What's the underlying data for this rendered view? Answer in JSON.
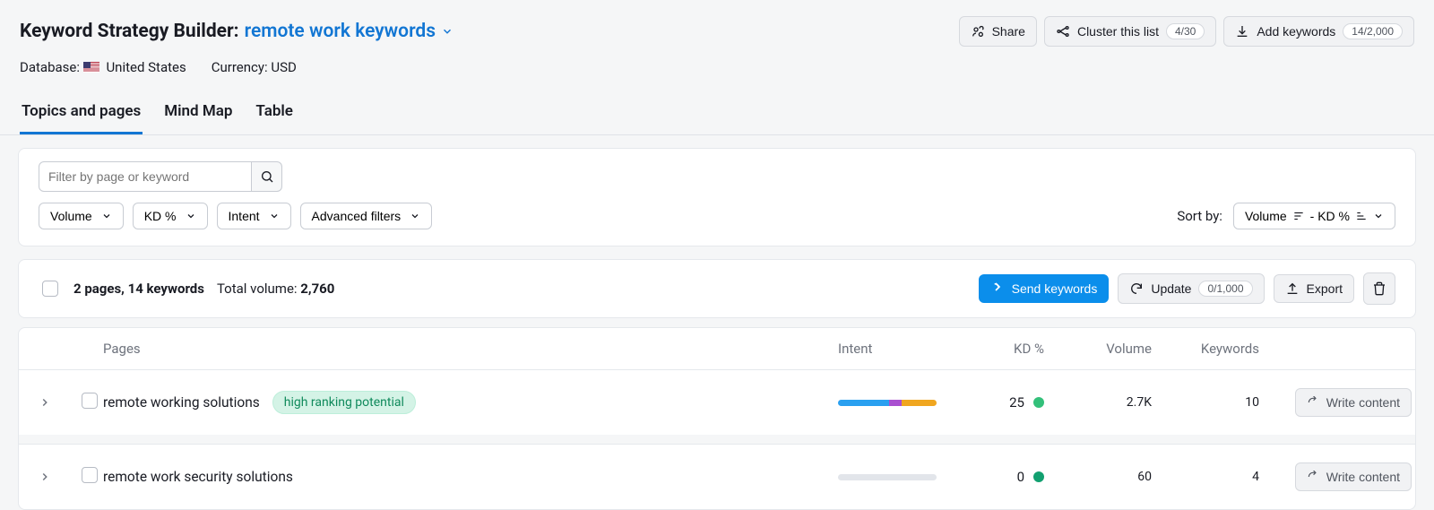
{
  "header": {
    "title_static": "Keyword Strategy Builder:",
    "title_link": "remote work keywords",
    "share_label": "Share",
    "cluster_label": "Cluster this list",
    "cluster_count": "4/30",
    "addkw_label": "Add keywords",
    "addkw_count": "14/2,000",
    "database_label": "Database:",
    "database_value": "United States",
    "currency_label": "Currency:",
    "currency_value": "USD"
  },
  "tabs": {
    "topics": "Topics and pages",
    "mindmap": "Mind Map",
    "table": "Table"
  },
  "filters": {
    "search_placeholder": "Filter by page or keyword",
    "volume": "Volume",
    "kd": "KD %",
    "intent": "Intent",
    "advanced": "Advanced filters",
    "sort_label": "Sort by:",
    "sort_value": "Volume",
    "sort_value2": "- KD %"
  },
  "summary": {
    "pages_keywords": "2 pages, 14 keywords",
    "total_volume_label": "Total volume:",
    "total_volume_value": "2,760",
    "send_label": "Send keywords",
    "update_label": "Update",
    "update_count": "0/1,000",
    "export_label": "Export"
  },
  "columns": {
    "pages": "Pages",
    "intent": "Intent",
    "kd": "KD %",
    "volume": "Volume",
    "keywords": "Keywords"
  },
  "rows": [
    {
      "name": "remote working solutions",
      "badge": "high ranking potential",
      "intent_segments": [
        {
          "cls": "blue",
          "w": 52
        },
        {
          "cls": "purple",
          "w": 13
        },
        {
          "cls": "orange",
          "w": 35
        }
      ],
      "kd": "25",
      "kd_dot": "green",
      "volume": "2.7K",
      "keywords": "10"
    },
    {
      "name": "remote work security solutions",
      "badge": "",
      "intent_segments": [],
      "kd": "0",
      "kd_dot": "teal",
      "volume": "60",
      "keywords": "4"
    }
  ],
  "misc": {
    "write_content": "Write content"
  }
}
